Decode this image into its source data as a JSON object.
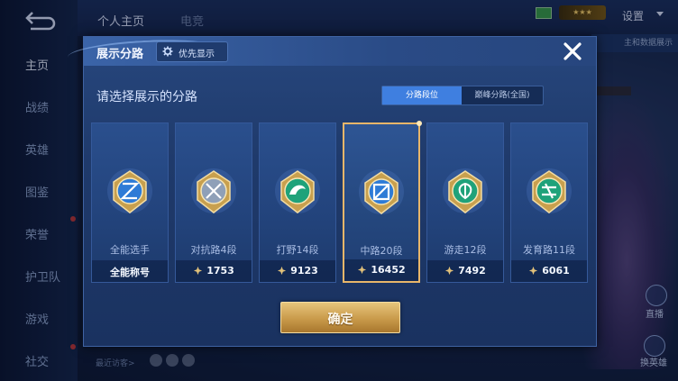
{
  "sidebar": {
    "items": [
      {
        "label": "主页",
        "active": true
      },
      {
        "label": "战绩",
        "active": false
      },
      {
        "label": "英雄",
        "active": false
      },
      {
        "label": "图鉴",
        "active": false
      },
      {
        "label": "荣誉",
        "active": false
      },
      {
        "label": "护卫队",
        "active": false
      },
      {
        "label": "游戏",
        "active": false
      },
      {
        "label": "社交",
        "active": false
      }
    ]
  },
  "topbar": {
    "tabs": [
      {
        "label": "个人主页"
      },
      {
        "label": "电竞"
      }
    ],
    "settings_label": "设置",
    "side_button_label": "主和数据展示"
  },
  "background": {
    "recent_label": "最近访客>",
    "watch_label": "直播",
    "switch_label": "换英雄"
  },
  "modal": {
    "title": "展示分路",
    "priority_label": "优先显示",
    "prompt": "请选择展示的分路",
    "toggle": {
      "options": [
        "分路段位",
        "巅峰分路(全国)"
      ],
      "selected_index": 0
    },
    "cards": [
      {
        "name": "全能选手",
        "score": "全能称号",
        "has_star": false,
        "selected": false,
        "emblem": "all-rounder-emblem"
      },
      {
        "name": "对抗路4段",
        "score": "1753",
        "has_star": true,
        "selected": false,
        "emblem": "clash-lane-emblem"
      },
      {
        "name": "打野14段",
        "score": "9123",
        "has_star": true,
        "selected": false,
        "emblem": "jungle-emblem"
      },
      {
        "name": "中路20段",
        "score": "16452",
        "has_star": true,
        "selected": true,
        "emblem": "mid-lane-emblem"
      },
      {
        "name": "游走12段",
        "score": "7492",
        "has_star": true,
        "selected": false,
        "emblem": "roam-emblem"
      },
      {
        "name": "发育路11段",
        "score": "6061",
        "has_star": true,
        "selected": false,
        "emblem": "farm-lane-emblem"
      }
    ],
    "confirm_label": "确定"
  },
  "colors": {
    "accent_gold": "#e8b66a",
    "toggle_active": "#3f7fe0",
    "modal_bg": "#1f3a6b"
  }
}
